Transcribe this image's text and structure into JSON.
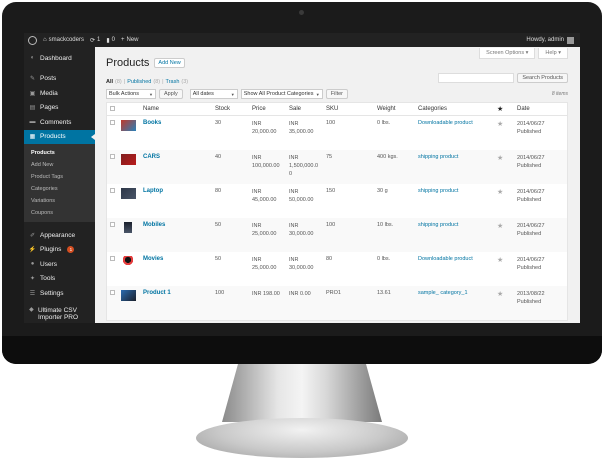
{
  "adminbar": {
    "site_name": "smackcoders",
    "updates_count": "1",
    "comments_count": "0",
    "new_label": "New",
    "greeting": "Howdy, admin"
  },
  "sidebar": {
    "items": [
      {
        "label": "Dashboard",
        "icon": "dashboard-icon"
      },
      {
        "label": "Posts",
        "icon": "pin-icon"
      },
      {
        "label": "Media",
        "icon": "media-icon"
      },
      {
        "label": "Pages",
        "icon": "page-icon"
      },
      {
        "label": "Comments",
        "icon": "comment-icon"
      },
      {
        "label": "Products",
        "icon": "cart-icon"
      }
    ],
    "submenu": [
      "Products",
      "Add New",
      "Product Tags",
      "Categories",
      "Variations",
      "Coupons"
    ],
    "lower_items": [
      {
        "label": "Appearance",
        "icon": "brush-icon"
      },
      {
        "label": "Plugins",
        "icon": "plug-icon",
        "badge": "1"
      },
      {
        "label": "Users",
        "icon": "user-icon"
      },
      {
        "label": "Tools",
        "icon": "wrench-icon"
      },
      {
        "label": "Settings",
        "icon": "settings-icon"
      },
      {
        "label": "Ultimate CSV Importer PRO",
        "icon": "plugin-icon"
      }
    ]
  },
  "header": {
    "screen_options": "Screen Options",
    "help": "Help",
    "title": "Products",
    "add_new": "Add New"
  },
  "views": {
    "all": "All",
    "all_count": "(8)",
    "published": "Published",
    "published_count": "(8)",
    "trash": "Trash",
    "trash_count": "(3)"
  },
  "search": {
    "button": "Search Products",
    "placeholder": ""
  },
  "tablenav": {
    "bulk_actions": "Bulk Actions",
    "apply": "Apply",
    "dates": "All dates",
    "category": "Show All Product Categories",
    "filter": "Filter",
    "items_count": "8 items"
  },
  "columns": {
    "name": "Name",
    "stock": "Stock",
    "price": "Price",
    "sale": "Sale",
    "sku": "SKU",
    "weight": "Weight",
    "categories": "Categories",
    "date": "Date"
  },
  "rows": [
    {
      "name": "Books",
      "stock": "30",
      "price": [
        "INR",
        "20,000.00"
      ],
      "sale": [
        "INR",
        "35,000.00"
      ],
      "sku": "100",
      "weight": "0 lbs.",
      "category": "Downloadable product",
      "date": [
        "2014/06/27",
        "Published"
      ]
    },
    {
      "name": "CARS",
      "stock": "40",
      "price": [
        "INR",
        "100,000.00"
      ],
      "sale": [
        "INR",
        "1,500,000.0",
        "0"
      ],
      "sku": "75",
      "weight": "400 kgs.",
      "category": "shipping product",
      "date": [
        "2014/06/27",
        "Published"
      ]
    },
    {
      "name": "Laptop",
      "stock": "80",
      "price": [
        "INR",
        "45,000.00"
      ],
      "sale": [
        "INR",
        "50,000.00"
      ],
      "sku": "150",
      "weight": "30 g",
      "category": "shipping product",
      "date": [
        "2014/06/27",
        "Published"
      ]
    },
    {
      "name": "Mobiles",
      "stock": "50",
      "price": [
        "INR",
        "25,000.00"
      ],
      "sale": [
        "INR",
        "30,000.00"
      ],
      "sku": "100",
      "weight": "10 lbs.",
      "category": "shipping product",
      "date": [
        "2014/06/27",
        "Published"
      ]
    },
    {
      "name": "Movies",
      "stock": "50",
      "price": [
        "INR",
        "25,000.00"
      ],
      "sale": [
        "INR",
        "30,000.00"
      ],
      "sku": "80",
      "weight": "0 lbs.",
      "category": "Downloadable product",
      "date": [
        "2014/06/27",
        "Published"
      ]
    },
    {
      "name": "Product 1",
      "stock": "100",
      "price": [
        "INR 198.00"
      ],
      "sale": [
        "INR 0.00"
      ],
      "sku": "PRO1",
      "weight": "13.61",
      "category": "sample_ category_1",
      "date": [
        "2013/08/22",
        "Published"
      ]
    }
  ],
  "colors": {
    "accent": "#0074a2",
    "adminbar": "#222222",
    "badge": "#d54e21"
  }
}
